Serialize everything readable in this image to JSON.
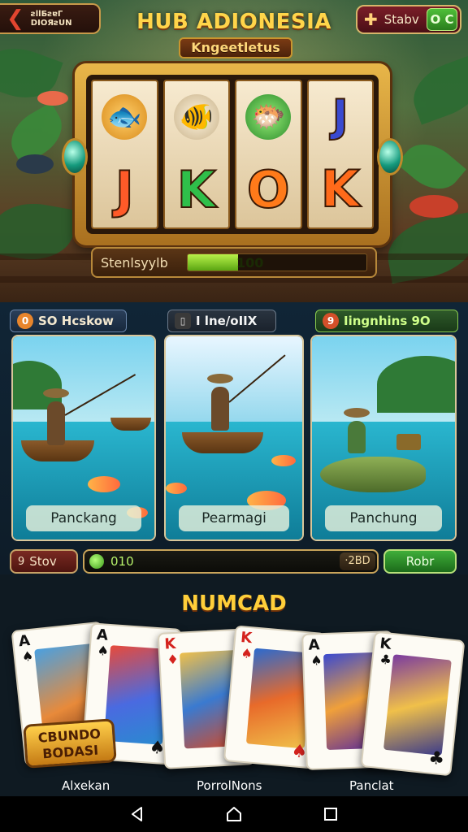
{
  "header": {
    "back_label_line1": "ƨllБƨɐГ",
    "back_label_line2": "DIOЯƨUN",
    "title": "HUB ADIONESIA",
    "subtitle": "Kngeetletus",
    "status_label": "Stabv",
    "status_value": "O C"
  },
  "slot": {
    "reel_letters": [
      "J",
      "K",
      "O",
      "K"
    ],
    "top_symbols": [
      "fish-gold",
      "fish-white",
      "fish-green",
      "J"
    ],
    "top_letter": "J",
    "progress_label": "Stenlsyylb",
    "progress_value": "100",
    "progress_fraction": 0.28
  },
  "activities": {
    "tags": [
      {
        "icon": "0",
        "label": "SO Hcskow"
      },
      {
        "icon": "▯",
        "label": "I lne/oIIX"
      },
      {
        "icon": "9",
        "label": "Iingnhins 9O"
      }
    ],
    "cards": [
      {
        "label": "Panckang"
      },
      {
        "label": "Pearmagi"
      },
      {
        "label": "Panchung"
      }
    ]
  },
  "actionbar": {
    "left_label": "Stov",
    "left_icon": "9",
    "bar_value": "010",
    "bar_end": "·2BD",
    "go_label": "Robr"
  },
  "cards_section": {
    "title": "NUMCAD",
    "logo_text_line1": "CBUNDO",
    "logo_text_line2": "BODASI",
    "cards": [
      {
        "rank": "A",
        "suit": "♠"
      },
      {
        "rank": "A",
        "suit": "♠"
      },
      {
        "rank": "K",
        "suit": "♦"
      },
      {
        "rank": "K",
        "suit": "♠"
      },
      {
        "rank": "A",
        "suit": "♠"
      },
      {
        "rank": "K",
        "suit": "♣"
      }
    ],
    "captions": [
      "Alxekan",
      "PorrolNons",
      "Panclat"
    ]
  },
  "colors": {
    "accent_gold": "#ffd54a",
    "go_green": "#3fae3a",
    "card_red": "#d4231e"
  }
}
